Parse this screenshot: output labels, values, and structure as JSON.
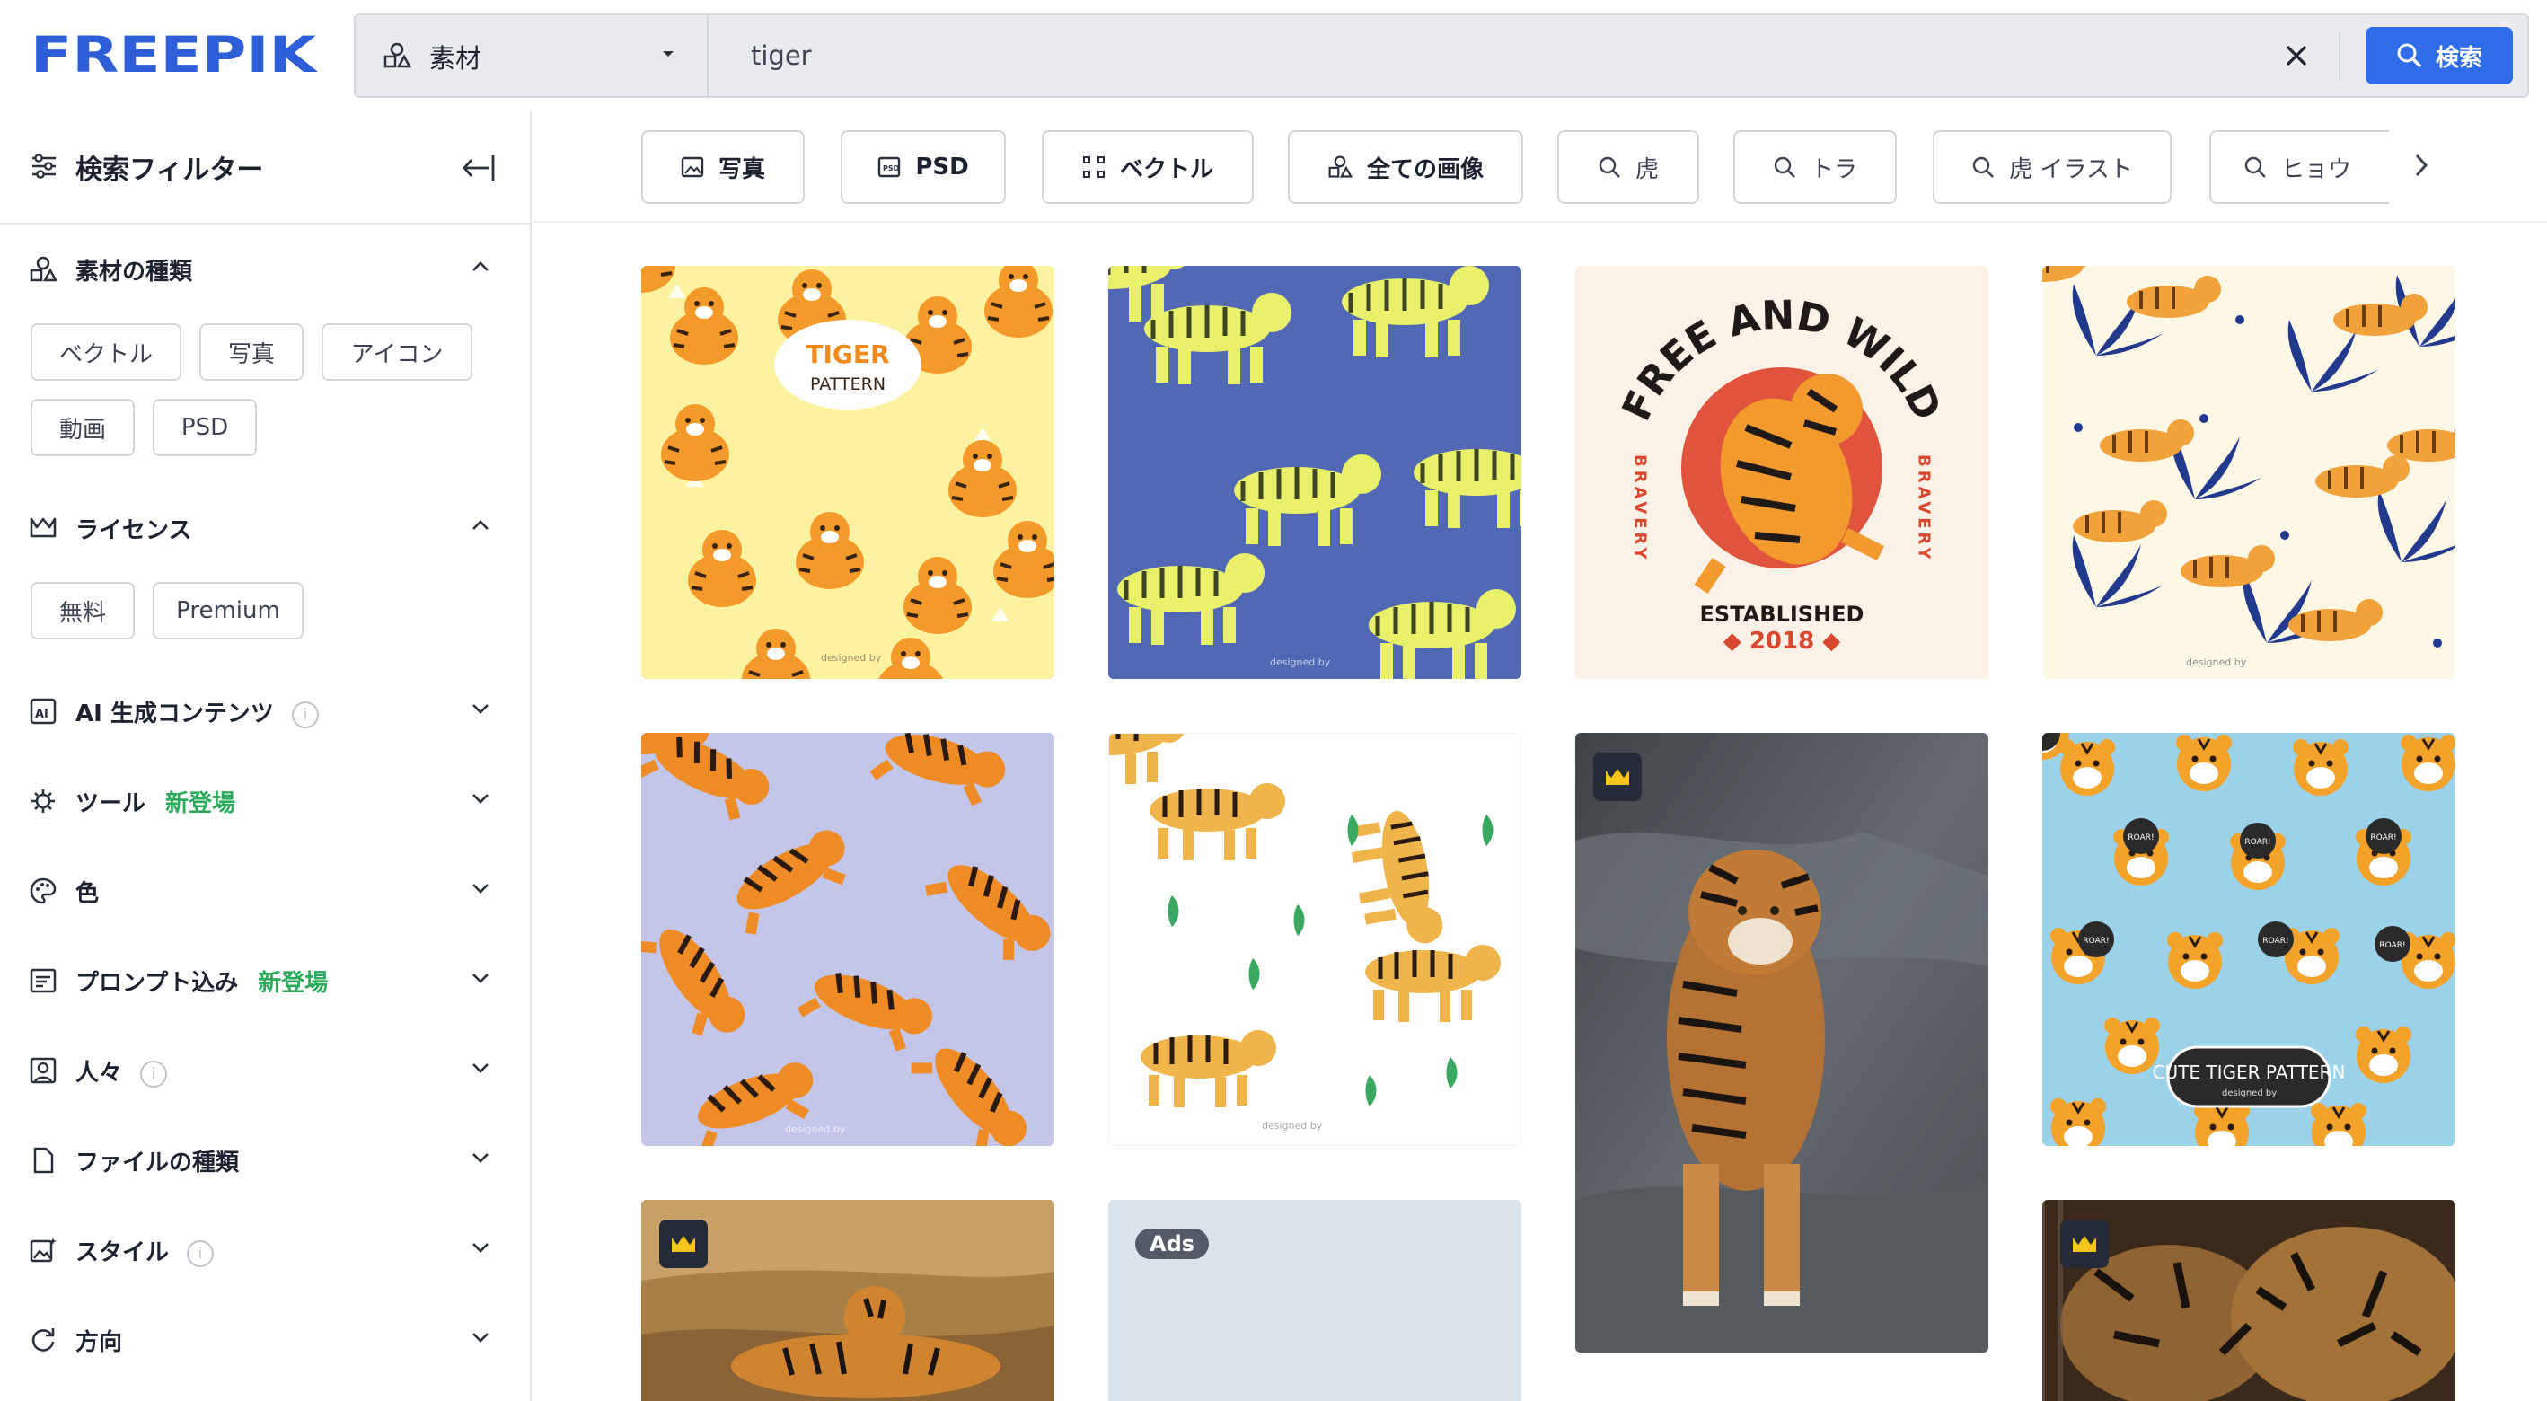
{
  "header": {
    "logo_text": "FREEPIK",
    "search_type": "素材",
    "search_value": "tiger",
    "search_button": "検索",
    "icons": [
      "assets-icon",
      "chevron-down-icon",
      "close-icon",
      "search-icon"
    ]
  },
  "sidebar": {
    "title": "検索フィルター",
    "sections": [
      {
        "label": "素材の種類",
        "expanded": true,
        "chips": [
          "ベクトル",
          "写真",
          "アイコン",
          "動画",
          "PSD"
        ]
      },
      {
        "label": "ライセンス",
        "expanded": true,
        "chips": [
          "無料",
          "Premium"
        ]
      },
      {
        "label": "AI 生成コンテンツ",
        "info": "i"
      },
      {
        "label": "ツール",
        "badge": "新登場"
      },
      {
        "label": "色"
      },
      {
        "label": "プロンプト込み",
        "badge": "新登場"
      },
      {
        "label": "人々",
        "info": "i"
      },
      {
        "label": "ファイルの種類"
      },
      {
        "label": "スタイル",
        "info": "i"
      },
      {
        "label": "方向"
      }
    ]
  },
  "topbar": {
    "chips": [
      "写真",
      "PSD",
      "ベクトル",
      "全ての画像",
      "虎",
      "トラ",
      "虎 イラスト",
      "ヒョウ"
    ]
  },
  "results": {
    "c1_title": "TIGER",
    "c1_sub": "PATTERN",
    "designed_by": "designed by",
    "c3_top": "FREE AND WILD",
    "c3_side": "BRAVERY",
    "c3_est": "ESTABLISHED",
    "c3_year": "◆ 2018 ◆",
    "c8_title": "CUTE TIGER PATTERN",
    "roar": "ROAR!",
    "ads": "Ads"
  },
  "colors": {
    "brand": "#2f6cea",
    "new_badge": "#2aaa5b",
    "premium_crown": "#f5c518"
  }
}
